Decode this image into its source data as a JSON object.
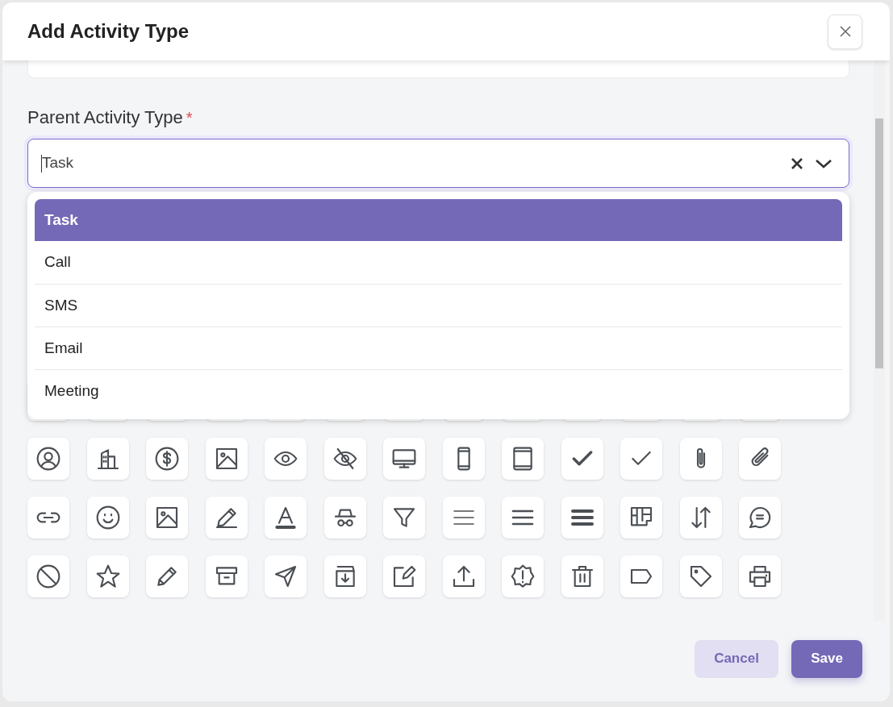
{
  "dialog": {
    "title": "Add Activity Type"
  },
  "field": {
    "label": "Parent Activity Type",
    "required_mark": "*",
    "value": "Task",
    "expanded": true,
    "options": [
      {
        "label": "Task",
        "selected": true
      },
      {
        "label": "Call",
        "selected": false
      },
      {
        "label": "SMS",
        "selected": false
      },
      {
        "label": "Email",
        "selected": false
      },
      {
        "label": "Meeting",
        "selected": false
      }
    ]
  },
  "buttons": [
    {
      "label": "Cancel",
      "kind": "secondary"
    },
    {
      "label": "Save",
      "kind": "primary"
    }
  ]
}
